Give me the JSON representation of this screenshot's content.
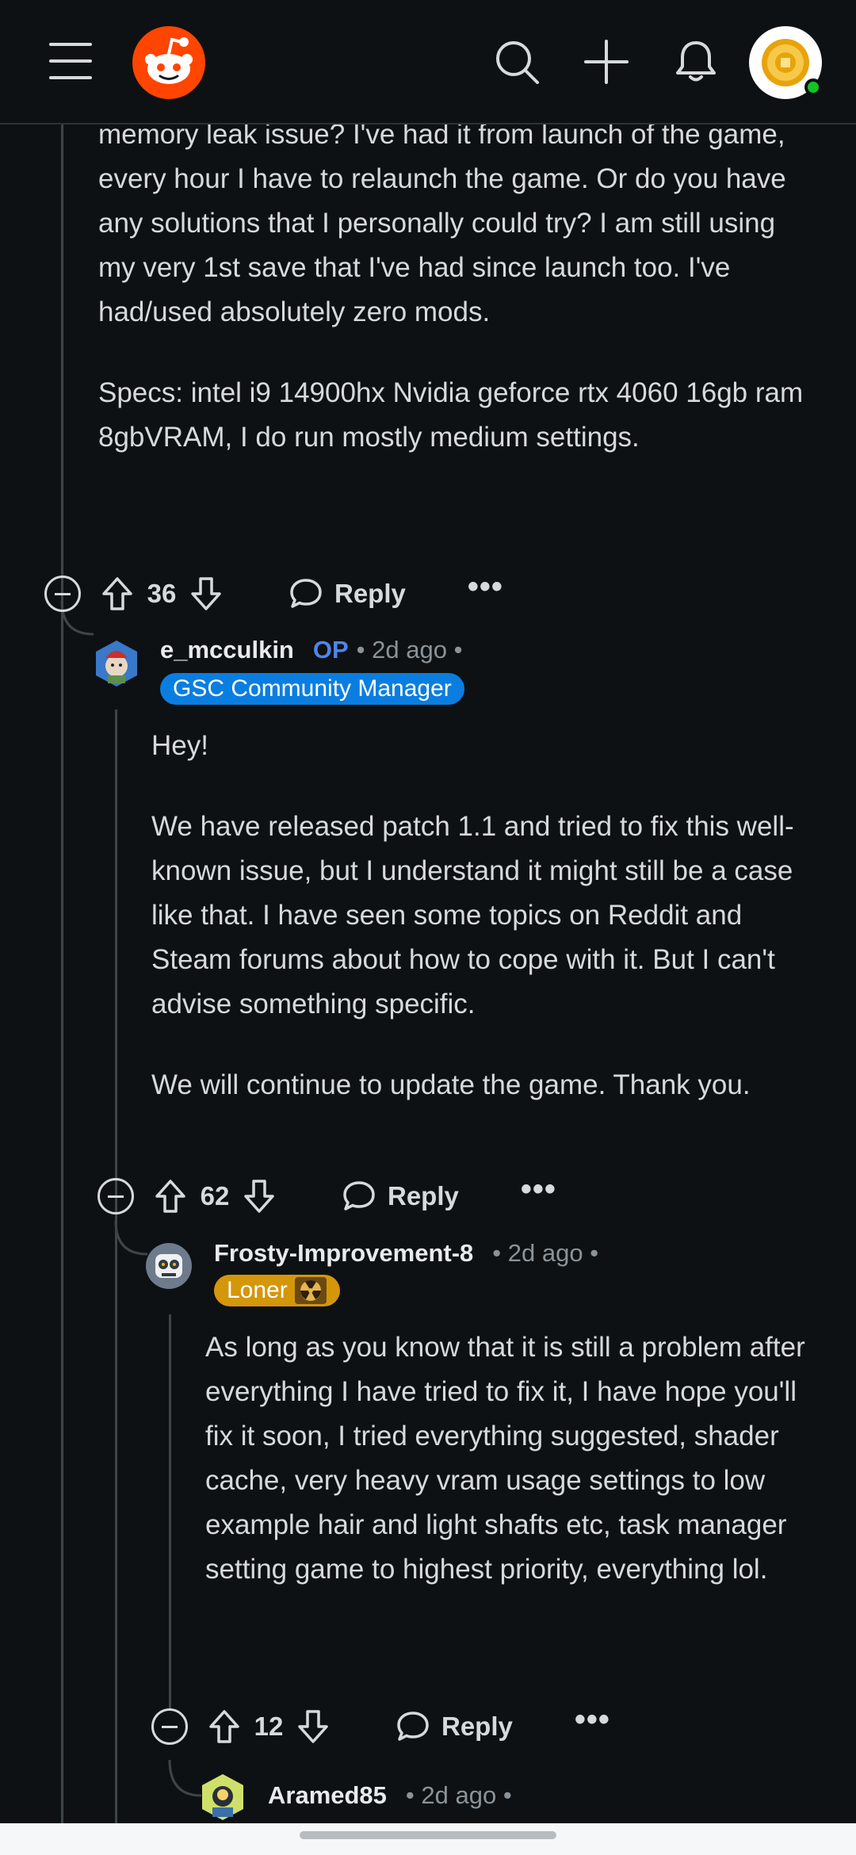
{
  "topbar": {
    "menu_icon": "hamburger-icon",
    "logo_icon": "reddit-snoo-logo",
    "search_icon": "search-icon",
    "create_icon": "plus-icon",
    "notifications_icon": "bell-icon",
    "avatar_icon": "user-avatar"
  },
  "comments": [
    {
      "id": "parent",
      "body_paragraphs": [
        "memory leak issue? I've had it from launch of the game, every hour I have to relaunch the game. Or do you have any solutions that I personally could try? I am still using my very 1st save that I've had since launch too. I've had/used absolutely zero mods.",
        "Specs: intel i9 14900hx Nvidia geforce rtx 4060 16gb ram 8gbVRAM, I do run mostly medium settings."
      ],
      "score": "36",
      "reply_label": "Reply",
      "more_label": "•••"
    },
    {
      "id": "reply1",
      "author": "e_mcculkin",
      "op_tag": "OP",
      "meta": "• 2d ago •",
      "flair": "GSC Community Manager",
      "body_paragraphs": [
        "Hey!",
        "We have released patch 1.1 and tried to fix this well-known issue, but I understand it might still be a case like that. I have seen some topics on Reddit and Steam forums about how to cope with it. But I can't advise something specific.",
        "We will continue to update the game. Thank you."
      ],
      "score": "62",
      "reply_label": "Reply",
      "more_label": "•••"
    },
    {
      "id": "reply2",
      "author": "Frosty-Improvement-8",
      "meta": "• 2d ago •",
      "flair": "Loner",
      "flair_icon": "radiation-icon",
      "body_paragraphs": [
        "As long as you know that it is still a problem after everything I have tried to fix it, I have hope you'll fix it soon, I tried everything suggested, shader cache, very heavy vram usage settings to low example hair and light shafts etc, task manager setting game to highest priority, everything lol."
      ],
      "score": "12",
      "reply_label": "Reply",
      "more_label": "•••"
    },
    {
      "id": "reply3",
      "author": "Aramed85",
      "meta": "• 2d ago •"
    }
  ],
  "colors": {
    "background": "#0e1113",
    "text": "#d7dadc",
    "op_tag": "#4e86ea",
    "flair_blue": "#0a7ee0",
    "flair_gold": "#d4960a",
    "online_dot": "#14c324"
  }
}
